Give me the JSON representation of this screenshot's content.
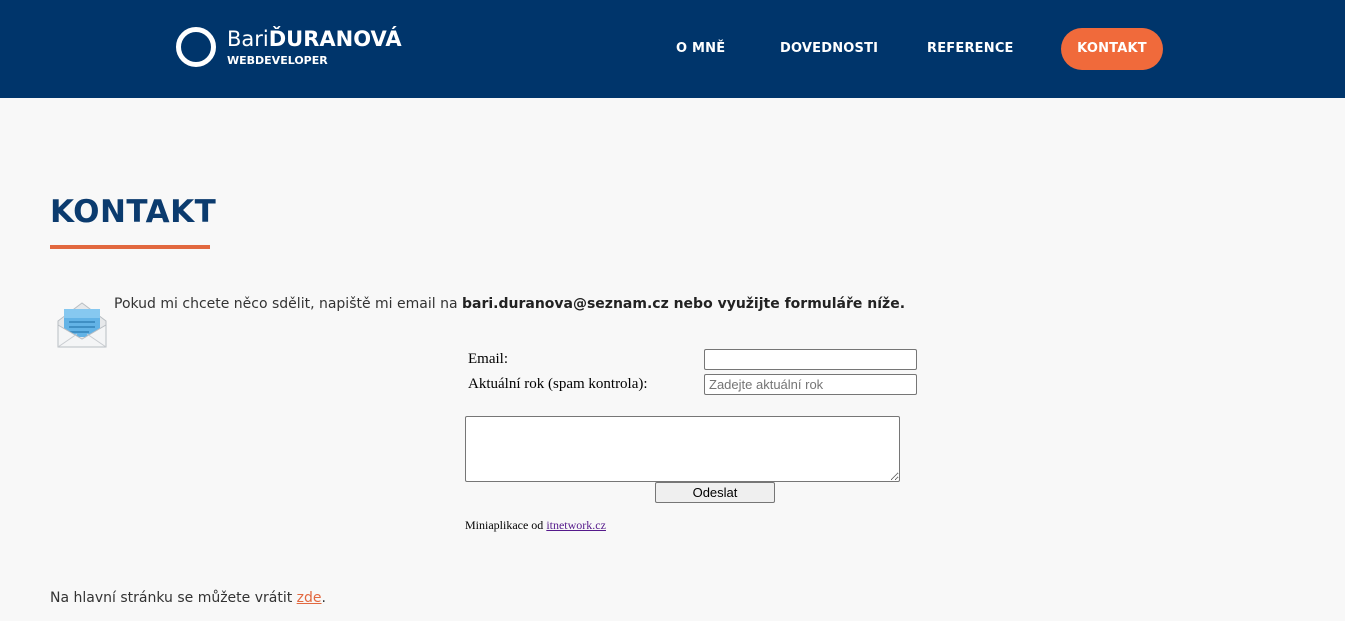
{
  "header": {
    "brand_first": "Bari",
    "brand_last": "ĎURANOVÁ",
    "brand_sub": "WEBDEVELOPER",
    "nav": {
      "about": "O MNĚ",
      "skills": "DOVEDNOSTI",
      "references": "REFERENCE",
      "contact": "KONTAKT"
    },
    "colors": {
      "background": "#00356b",
      "accent": "#f06a3b"
    }
  },
  "main": {
    "title": "KONTAKT",
    "intro_text": "Pokud mi chcete něco sdělit, napiště mi email na ",
    "intro_email": "bari.duranova@seznam.cz",
    "intro_rest": " nebo využijte formuláře níže.",
    "icon": "envelope-icon"
  },
  "form": {
    "email_label": "Email:",
    "email_value": "",
    "year_label": "Aktuální rok (spam kontrola):",
    "year_placeholder": "Zadejte aktuální rok",
    "message_value": "",
    "send_label": "Odeslat",
    "credit_text": "Miniaplikace od ",
    "credit_link": "itnetwork.cz"
  },
  "footer": {
    "back_text": "Na hlavní stránku se můžete vrátit ",
    "back_link": "zde",
    "back_end": "."
  }
}
